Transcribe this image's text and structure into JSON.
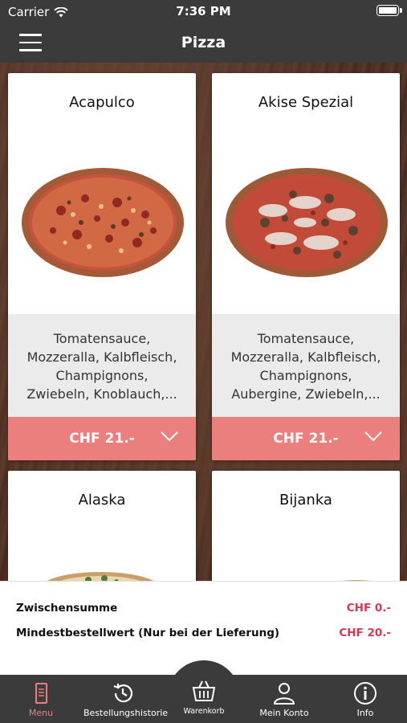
{
  "status_bar": {
    "carrier": "Carrier",
    "time": "7:36 PM"
  },
  "nav": {
    "title": "Pizza"
  },
  "products": [
    {
      "name": "Acapulco",
      "description_lines": [
        "Tomatensauce,",
        "Mozzeralla, Kalbfleisch,",
        "Champignons,",
        "Zwiebeln, Knoblauch,..."
      ],
      "price": "CHF 21.-"
    },
    {
      "name": "Akise Spezial",
      "description_lines": [
        "Tomatensauce,",
        "Mozzeralla, Kalbfleisch,",
        "Champignons,",
        "Aubergine, Zwiebeln,..."
      ],
      "price": "CHF 21.-"
    },
    {
      "name": "Alaska"
    },
    {
      "name": "Bijanka"
    }
  ],
  "summary": {
    "subtotal_label": "Zwischensumme",
    "subtotal_value": "CHF 0.-",
    "minimum_label": "Mindestbestellwert (Nur bei der Lieferung)",
    "minimum_value": "CHF 20.-"
  },
  "tabs": [
    {
      "label": "Menu",
      "icon": "menu-card-icon",
      "active": true
    },
    {
      "label": "Bestellungshistorie",
      "icon": "history-icon",
      "active": false
    },
    {
      "label": "Warenkorb",
      "icon": "basket-icon",
      "active": false
    },
    {
      "label": "Mein Konto",
      "icon": "user-icon",
      "active": false
    },
    {
      "label": "Info",
      "icon": "info-icon",
      "active": false
    }
  ],
  "colors": {
    "accent": "#ea7f7d",
    "price_red": "#e0334f",
    "bar_dark": "#3b3b3b"
  }
}
